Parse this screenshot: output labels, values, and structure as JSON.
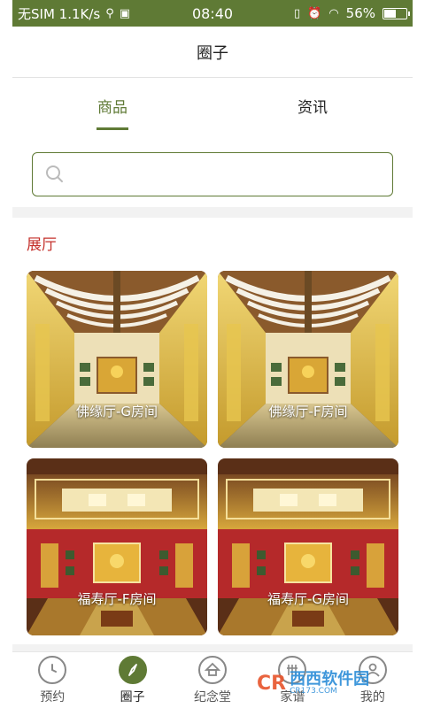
{
  "status_bar": {
    "carrier": "无SIM 1.1K/s",
    "time": "08:40",
    "battery": "56%",
    "battery_level": 0.56
  },
  "header": {
    "title": "圈子"
  },
  "tabs": [
    {
      "label": "商品",
      "active": true
    },
    {
      "label": "资讯",
      "active": false
    }
  ],
  "search": {
    "placeholder": "",
    "value": ""
  },
  "section": {
    "title": "展厅"
  },
  "cards": [
    {
      "label": "佛缘厅-G房间",
      "scene": "buddha-hall"
    },
    {
      "label": "佛缘厅-F房间",
      "scene": "buddha-hall"
    },
    {
      "label": "福寿厅-F房间",
      "scene": "fortune-hall"
    },
    {
      "label": "福寿厅-G房间",
      "scene": "fortune-hall"
    }
  ],
  "bottom_nav": [
    {
      "label": "预约",
      "icon": "clock-icon",
      "active": false
    },
    {
      "label": "圈子",
      "icon": "compass-icon",
      "active": true
    },
    {
      "label": "纪念堂",
      "icon": "home-icon",
      "active": false
    },
    {
      "label": "家谱",
      "icon": "family-tree-icon",
      "active": false
    },
    {
      "label": "我的",
      "icon": "user-icon",
      "active": false
    }
  ],
  "watermark": {
    "logo": "CR",
    "main": "西西软件园",
    "sub": "CR173.COM"
  },
  "colors": {
    "accent": "#5f7a35",
    "section_title": "#c4302b"
  }
}
